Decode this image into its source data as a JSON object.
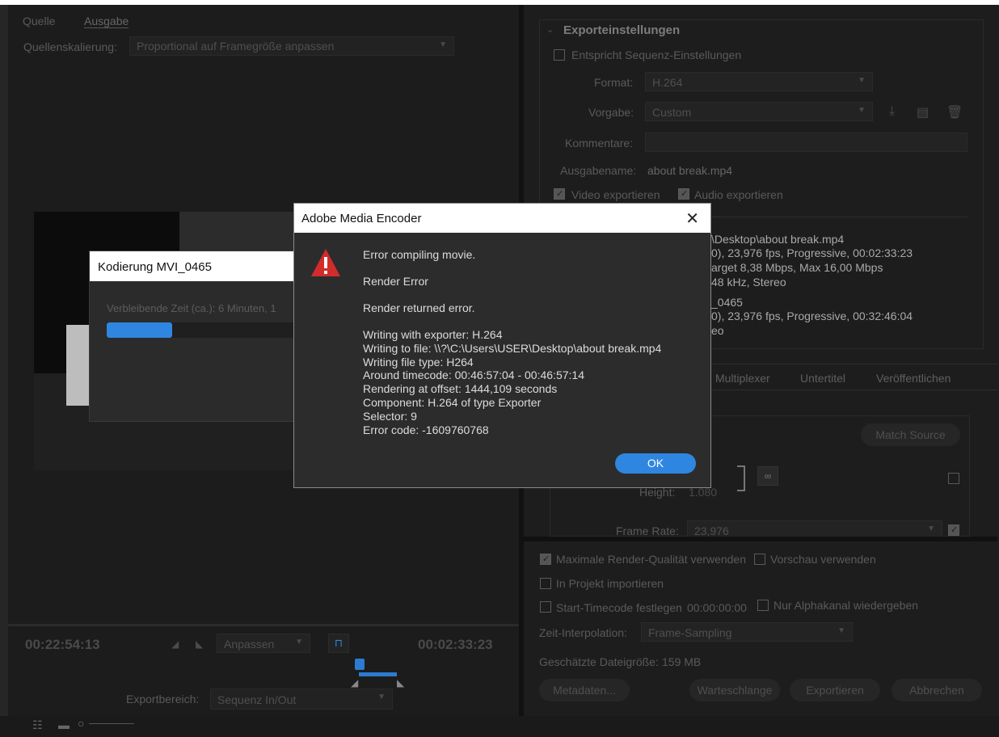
{
  "left": {
    "tabs": [
      "Quelle",
      "Ausgabe"
    ],
    "source_scaling_label": "Quellenskalierung:",
    "source_scaling_value": "Proportional auf Framegröße anpassen",
    "timecode_in": "00:22:54:13",
    "timecode_out": "00:02:33:23",
    "fit_value": "Anpassen",
    "export_range_label": "Exportbereich:",
    "export_range_value": "Sequenz In/Out"
  },
  "right": {
    "section_title": "Exporteinstellungen",
    "match_sequence_label": "Entspricht Sequenz-Einstellungen",
    "format_label": "Format:",
    "format_value": "H.264",
    "preset_label": "Vorgabe:",
    "preset_value": "Custom",
    "comments_label": "Kommentare:",
    "output_name_label": "Ausgabename:",
    "output_name_value": "about break.mp4",
    "export_video_label": "Video exportieren",
    "export_audio_label": "Audio exportieren",
    "summary_lines": [
      "\\Desktop\\about break.mp4",
      "0), 23,976 fps, Progressive, 00:02:33:23",
      "arget 8,38 Mbps, Max 16,00 Mbps",
      " 48 kHz, Stereo",
      "_0465",
      "0), 23,976 fps, Progressive, 00:32:46:04",
      "eo"
    ],
    "tabs": [
      "Multiplexer",
      "Untertitel",
      "Veröffentlichen"
    ],
    "match_source_label": "Match Source",
    "height_label": "Height:",
    "height_value": "1.080",
    "width_partial": "0",
    "frame_rate_label": "Frame Rate:",
    "frame_rate_value": "23,976",
    "max_render_quality_label": "Maximale Render-Qualität verwenden",
    "use_preview_label": "Vorschau verwenden",
    "import_into_project_label": "In Projekt importieren",
    "set_start_timecode_label": "Start-Timecode festlegen",
    "start_timecode_value": "00:00:00:00",
    "alpha_only_label": "Nur Alphakanal wiedergeben",
    "time_interpolation_label": "Zeit-Interpolation:",
    "time_interpolation_value": "Frame-Sampling",
    "estimated_size_label": "Geschätzte Dateigröße:",
    "estimated_size_value": "159 MB",
    "metadata_button": "Metadaten...",
    "queue_button": "Warteschlange",
    "export_button": "Exportieren",
    "cancel_button": "Abbrechen"
  },
  "encoding_dialog": {
    "title": "Kodierung MVI_0465",
    "remaining": "Verbleibende Zeit (ca.): 6 Minuten, 1",
    "progress_fraction": 0.34
  },
  "error_dialog": {
    "title": "Adobe Media Encoder",
    "line1": "Error compiling movie.",
    "line2": "Render Error",
    "line3": "Render returned error.",
    "details": [
      "Writing with exporter: H.264",
      "Writing to file: \\\\?\\C:\\Users\\USER\\Desktop\\about break.mp4",
      "Writing file type: H264",
      "Around timecode: 00:46:57:04 - 00:46:57:14",
      "Rendering at offset: 1444,109 seconds",
      "Component: H.264 of type Exporter",
      "Selector: 9",
      "Error code: -1609760768"
    ],
    "ok_label": "OK",
    "warning_color": "#d22b2b"
  },
  "colors": {
    "accent": "#2f86e0"
  }
}
